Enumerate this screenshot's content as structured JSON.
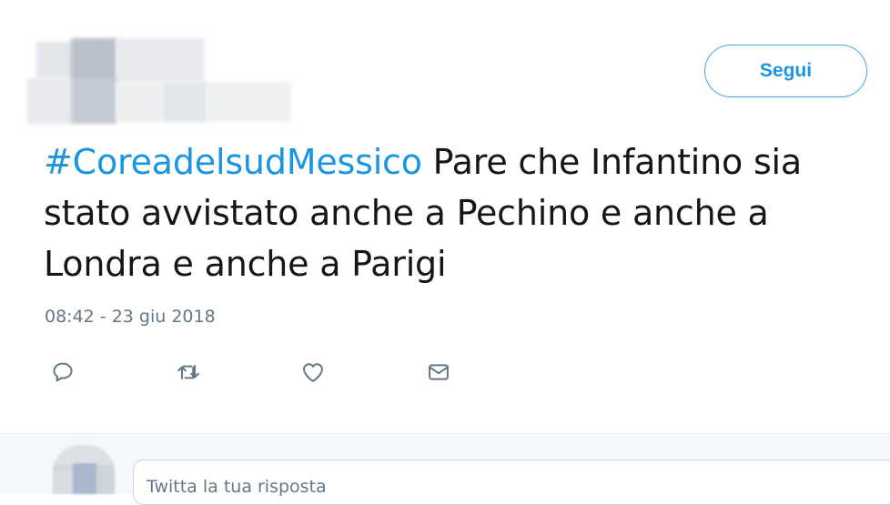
{
  "tweet": {
    "follow_label": "Segui",
    "hashtag": "#CoreadelsudMessico",
    "text": " Pare che Infantino sia stato avvistato anche a Pechino e anche a Londra e anche a Parigi",
    "timestamp": "08:42 - 23 giu 2018",
    "actions": [
      {
        "name": "reply",
        "icon": "speech-bubble-icon"
      },
      {
        "name": "retweet",
        "icon": "retweet-icon"
      },
      {
        "name": "like",
        "icon": "heart-icon"
      },
      {
        "name": "message",
        "icon": "envelope-icon"
      }
    ]
  },
  "reply": {
    "placeholder": "Twitta la tua risposta"
  },
  "colors": {
    "accent": "#1b95e0",
    "text": "#14171a",
    "muted": "#657786",
    "reply_bg": "#f5f8fa"
  }
}
